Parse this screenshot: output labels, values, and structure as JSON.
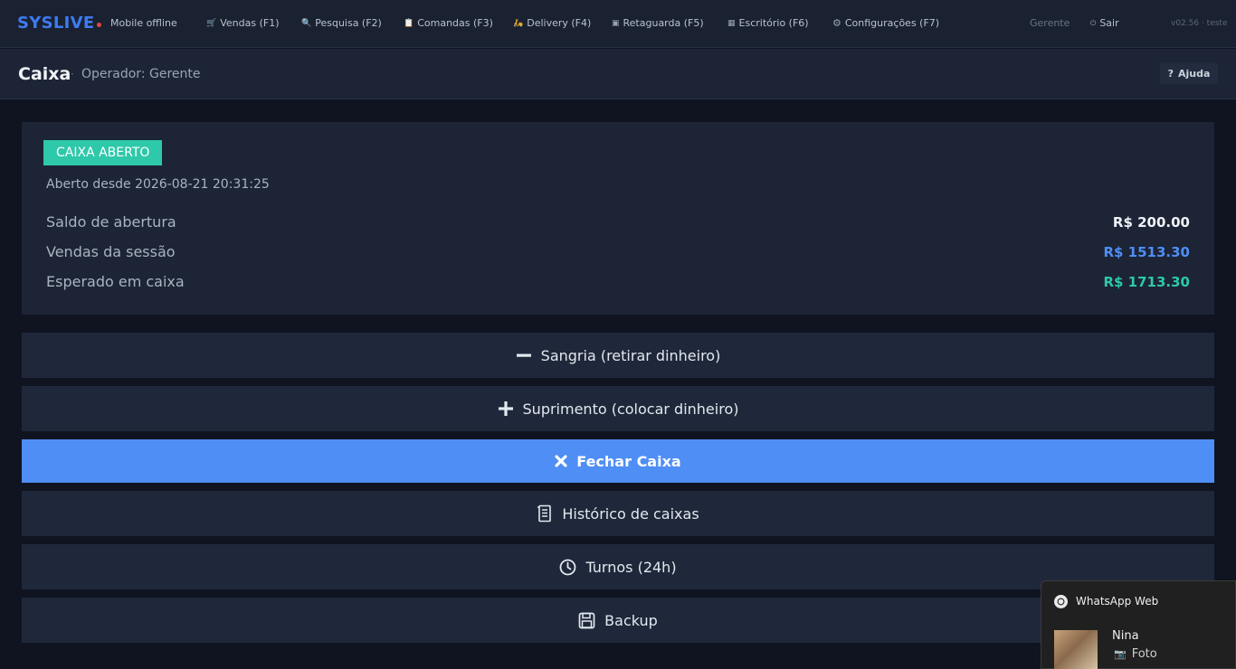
{
  "nav": {
    "brand": "SYSLIVE",
    "mobile_status": "Mobile offline",
    "items": [
      {
        "label": "Vendas (F1)",
        "icon": "cart-icon"
      },
      {
        "label": "Pesquisa (F2)",
        "icon": "search-icon"
      },
      {
        "label": "Comandas (F3)",
        "icon": "clipboard-icon"
      },
      {
        "label": "Delivery (F4)",
        "icon": "delivery-icon"
      },
      {
        "label": "Retaguarda (F5)",
        "icon": "box-icon"
      },
      {
        "label": "Escritório (F6)",
        "icon": "building-icon"
      },
      {
        "label": "Configurações (F7)",
        "icon": "gear-icon"
      }
    ],
    "user": "Gerente",
    "logout": "Sair",
    "version": "v02.56 · teste"
  },
  "page": {
    "title": "Caixa",
    "separator": "·",
    "subtitle": "Operador: Gerente",
    "help": "Ajuda"
  },
  "summary": {
    "status_badge": "CAIXA ABERTO",
    "opened_since": "Aberto desde 2026-08-21 20:31:25",
    "rows": [
      {
        "label": "Saldo de abertura",
        "value": "R$ 200.00",
        "color": "#f0f3f7"
      },
      {
        "label": "Vendas da sessão",
        "value": "R$ 1513.30",
        "color": "#4f8ef5"
      },
      {
        "label": "Esperado em caixa",
        "value": "R$ 1713.30",
        "color": "#2ec8aa"
      }
    ]
  },
  "actions": [
    {
      "label": "Sangria (retirar dinheiro)",
      "icon": "minus-icon"
    },
    {
      "label": "Suprimento (colocar dinheiro)",
      "icon": "plus-icon"
    },
    {
      "label": "Fechar Caixa",
      "icon": "close-icon"
    },
    {
      "label": "Histórico de caixas",
      "icon": "receipt-icon"
    },
    {
      "label": "Turnos (24h)",
      "icon": "clock-icon"
    },
    {
      "label": "Backup",
      "icon": "save-icon"
    }
  ],
  "notification": {
    "app": "WhatsApp Web",
    "sender": "Nina",
    "message": "Foto"
  },
  "colors": {
    "accent": "#4f8ef5",
    "success": "#2ec8aa",
    "brand": "#3d7bf0"
  }
}
